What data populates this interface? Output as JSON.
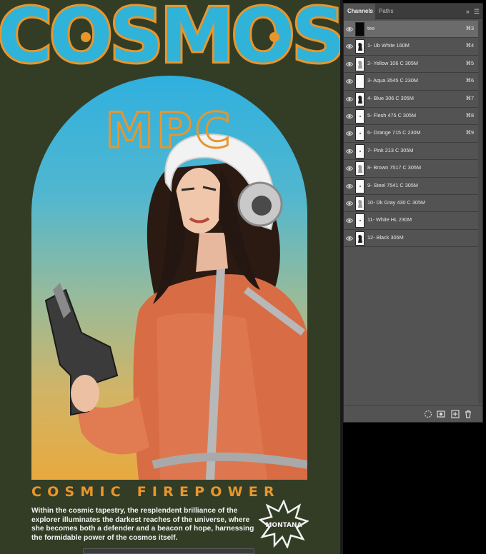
{
  "artwork": {
    "title": "COSMOS",
    "monogram": "MPC",
    "tagline": "COSMIC FIREPOWER",
    "blurb": "Within the cosmic tapestry, the resplendent brilliance of the explorer illuminates the darkest reaches of the universe, where she becomes both a defender and a beacon of hope, harnessing the formidable power of the cosmos itself.",
    "logo_text": "MONTANA",
    "colors": {
      "background": "#333d26",
      "title_fill": "#2fb3d9",
      "title_outline": "#e8962c",
      "accent_orange": "#e8962c",
      "sky_top": "#2fb0df",
      "sky_bottom": "#e8a93f"
    }
  },
  "panel": {
    "tabs": [
      "Channels",
      "Paths"
    ],
    "menu_icons": [
      "collapse-icon",
      "panel-menu-icon"
    ],
    "channels": [
      {
        "name": "tee",
        "shortcut": "⌘3",
        "visible": true,
        "selected": true,
        "thumb": "black"
      },
      {
        "name": "1- Ub White 160M",
        "shortcut": "⌘4",
        "visible": true,
        "selected": false,
        "thumb": "figure-dark"
      },
      {
        "name": "2- Yellow 106 C 305M",
        "shortcut": "⌘5",
        "visible": true,
        "selected": false,
        "thumb": "figure-light"
      },
      {
        "name": "3- Aqua 3545 C 230M",
        "shortcut": "⌘6",
        "visible": true,
        "selected": false,
        "thumb": "blank"
      },
      {
        "name": "4- Blue 306 C 305M",
        "shortcut": "⌘7",
        "visible": true,
        "selected": false,
        "thumb": "figure-dark"
      },
      {
        "name": "5- Flesh 475 C 305M",
        "shortcut": "⌘8",
        "visible": true,
        "selected": false,
        "thumb": "speck"
      },
      {
        "name": "6- Orange 715 C 230M",
        "shortcut": "⌘9",
        "visible": true,
        "selected": false,
        "thumb": "speck"
      },
      {
        "name": "7- Pink 213 C 305M",
        "shortcut": "",
        "visible": true,
        "selected": false,
        "thumb": "speck"
      },
      {
        "name": "8- Brown 7517 C 305M",
        "shortcut": "",
        "visible": true,
        "selected": false,
        "thumb": "figure-light"
      },
      {
        "name": "9- Steel 7541 C 305M",
        "shortcut": "",
        "visible": true,
        "selected": false,
        "thumb": "speck"
      },
      {
        "name": "10- Dk Gray 430 C 305M",
        "shortcut": "",
        "visible": true,
        "selected": false,
        "thumb": "figure-light"
      },
      {
        "name": "11- White HL 230M",
        "shortcut": "",
        "visible": true,
        "selected": false,
        "thumb": "speck"
      },
      {
        "name": "12- Black 305M",
        "shortcut": "",
        "visible": true,
        "selected": false,
        "thumb": "figure-dark"
      }
    ],
    "footer_icons": [
      "load-selection-icon",
      "save-selection-icon",
      "new-channel-icon",
      "delete-channel-icon"
    ]
  }
}
